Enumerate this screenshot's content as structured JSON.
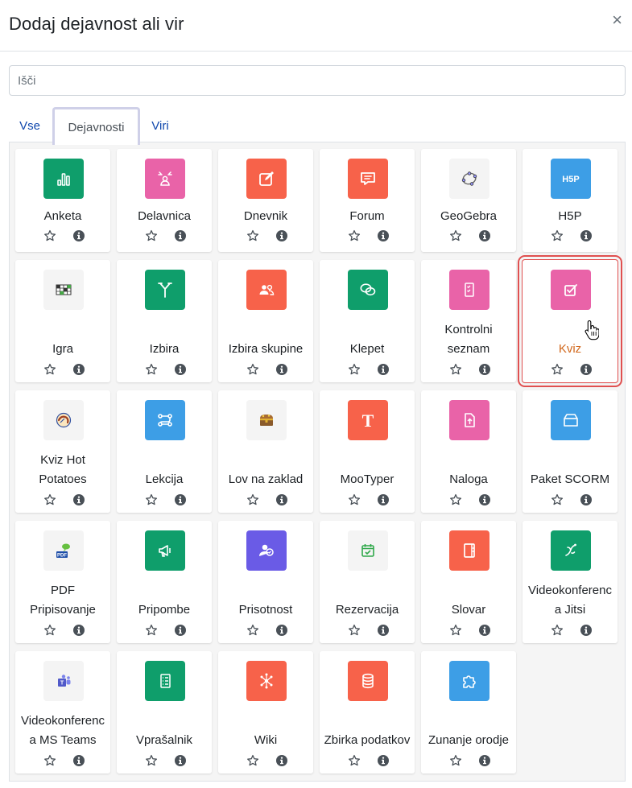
{
  "modal": {
    "title": "Dodaj dejavnost ali vir",
    "close_label": "×"
  },
  "search": {
    "placeholder": "Išči"
  },
  "tabs": [
    {
      "label": "Vse"
    },
    {
      "label": "Dejavnosti",
      "active": true
    },
    {
      "label": "Viri"
    }
  ],
  "colors": {
    "green": "#0f9e6b",
    "pink": "#e963a8",
    "orange": "#f7624a",
    "blue": "#3d9ee6",
    "purple": "#6a5be6",
    "light": "#f4f4f4"
  },
  "activities": [
    {
      "name": "Anketa",
      "lines": [
        "Anketa"
      ],
      "icon": "bar-chart-icon",
      "color": "#0f9e6b"
    },
    {
      "name": "Delavnica",
      "lines": [
        "Delavnica"
      ],
      "icon": "workshop-icon",
      "color": "#e963a8"
    },
    {
      "name": "Dnevnik",
      "lines": [
        "Dnevnik"
      ],
      "icon": "edit-icon",
      "color": "#f7624a"
    },
    {
      "name": "Forum",
      "lines": [
        "Forum"
      ],
      "icon": "forum-icon",
      "color": "#f7624a"
    },
    {
      "name": "GeoGebra",
      "lines": [
        "GeoGebra"
      ],
      "icon": "geogebra-icon",
      "color": "#f4f4f4"
    },
    {
      "name": "H5P",
      "lines": [
        "H5P"
      ],
      "icon": "h5p-icon",
      "color": "#3d9ee6"
    },
    {
      "name": "Igra",
      "lines": [
        "Igra"
      ],
      "icon": "crossword-icon",
      "color": "#f4f4f4"
    },
    {
      "name": "Izbira",
      "lines": [
        "Izbira"
      ],
      "icon": "choice-icon",
      "color": "#0f9e6b"
    },
    {
      "name": "Izbira skupine",
      "lines": [
        "Izbira skupine"
      ],
      "icon": "group-icon",
      "color": "#f7624a"
    },
    {
      "name": "Klepet",
      "lines": [
        "Klepet"
      ],
      "icon": "chat-icon",
      "color": "#0f9e6b"
    },
    {
      "name": "Kontrolni seznam",
      "lines": [
        "Kontrolni",
        "seznam"
      ],
      "icon": "checklist-icon",
      "color": "#e963a8"
    },
    {
      "name": "Kviz",
      "lines": [
        "Kviz"
      ],
      "icon": "quiz-icon",
      "color": "#e963a8",
      "selected": true
    },
    {
      "name": "Kviz Hot Potatoes",
      "lines": [
        "Kviz Hot",
        "Potatoes"
      ],
      "icon": "hotpot-icon",
      "color": "#f4f4f4"
    },
    {
      "name": "Lekcija",
      "lines": [
        "Lekcija"
      ],
      "icon": "lesson-icon",
      "color": "#3d9ee6"
    },
    {
      "name": "Lov na zaklad",
      "lines": [
        "Lov na zaklad"
      ],
      "icon": "treasure-icon",
      "color": "#f4f4f4"
    },
    {
      "name": "MooTyper",
      "lines": [
        "MooTyper"
      ],
      "icon": "mootyper-icon",
      "color": "#f7624a"
    },
    {
      "name": "Naloga",
      "lines": [
        "Naloga"
      ],
      "icon": "assignment-icon",
      "color": "#e963a8"
    },
    {
      "name": "Paket SCORM",
      "lines": [
        "Paket SCORM"
      ],
      "icon": "scorm-icon",
      "color": "#3d9ee6"
    },
    {
      "name": "PDF Pripisovanje",
      "lines": [
        "PDF",
        "Pripisovanje"
      ],
      "icon": "pdf-icon",
      "color": "#f4f4f4"
    },
    {
      "name": "Pripombe",
      "lines": [
        "Pripombe"
      ],
      "icon": "megaphone-icon",
      "color": "#0f9e6b"
    },
    {
      "name": "Prisotnost",
      "lines": [
        "Prisotnost"
      ],
      "icon": "attendance-icon",
      "color": "#6a5be6"
    },
    {
      "name": "Rezervacija",
      "lines": [
        "Rezervacija"
      ],
      "icon": "calendar-check-icon",
      "color": "#f4f4f4"
    },
    {
      "name": "Slovar",
      "lines": [
        "Slovar"
      ],
      "icon": "glossary-icon",
      "color": "#f7624a"
    },
    {
      "name": "Videokonferenca Jitsi",
      "lines": [
        "Videokonferenc",
        "a Jitsi"
      ],
      "icon": "jitsi-icon",
      "color": "#0f9e6b"
    },
    {
      "name": "Videokonferenca MS Teams",
      "lines": [
        "Videokonferenc",
        "a MS Teams"
      ],
      "icon": "teams-icon",
      "color": "#f4f4f4"
    },
    {
      "name": "Vprašalnik",
      "lines": [
        "Vprašalnik"
      ],
      "icon": "questionnaire-icon",
      "color": "#0f9e6b"
    },
    {
      "name": "Wiki",
      "lines": [
        "Wiki"
      ],
      "icon": "wiki-icon",
      "color": "#f7624a"
    },
    {
      "name": "Zbirka podatkov",
      "lines": [
        "Zbirka podatkov"
      ],
      "icon": "database-icon",
      "color": "#f7624a"
    },
    {
      "name": "Zunanje orodje",
      "lines": [
        "Zunanje orodje"
      ],
      "icon": "puzzle-icon",
      "color": "#3d9ee6"
    }
  ]
}
